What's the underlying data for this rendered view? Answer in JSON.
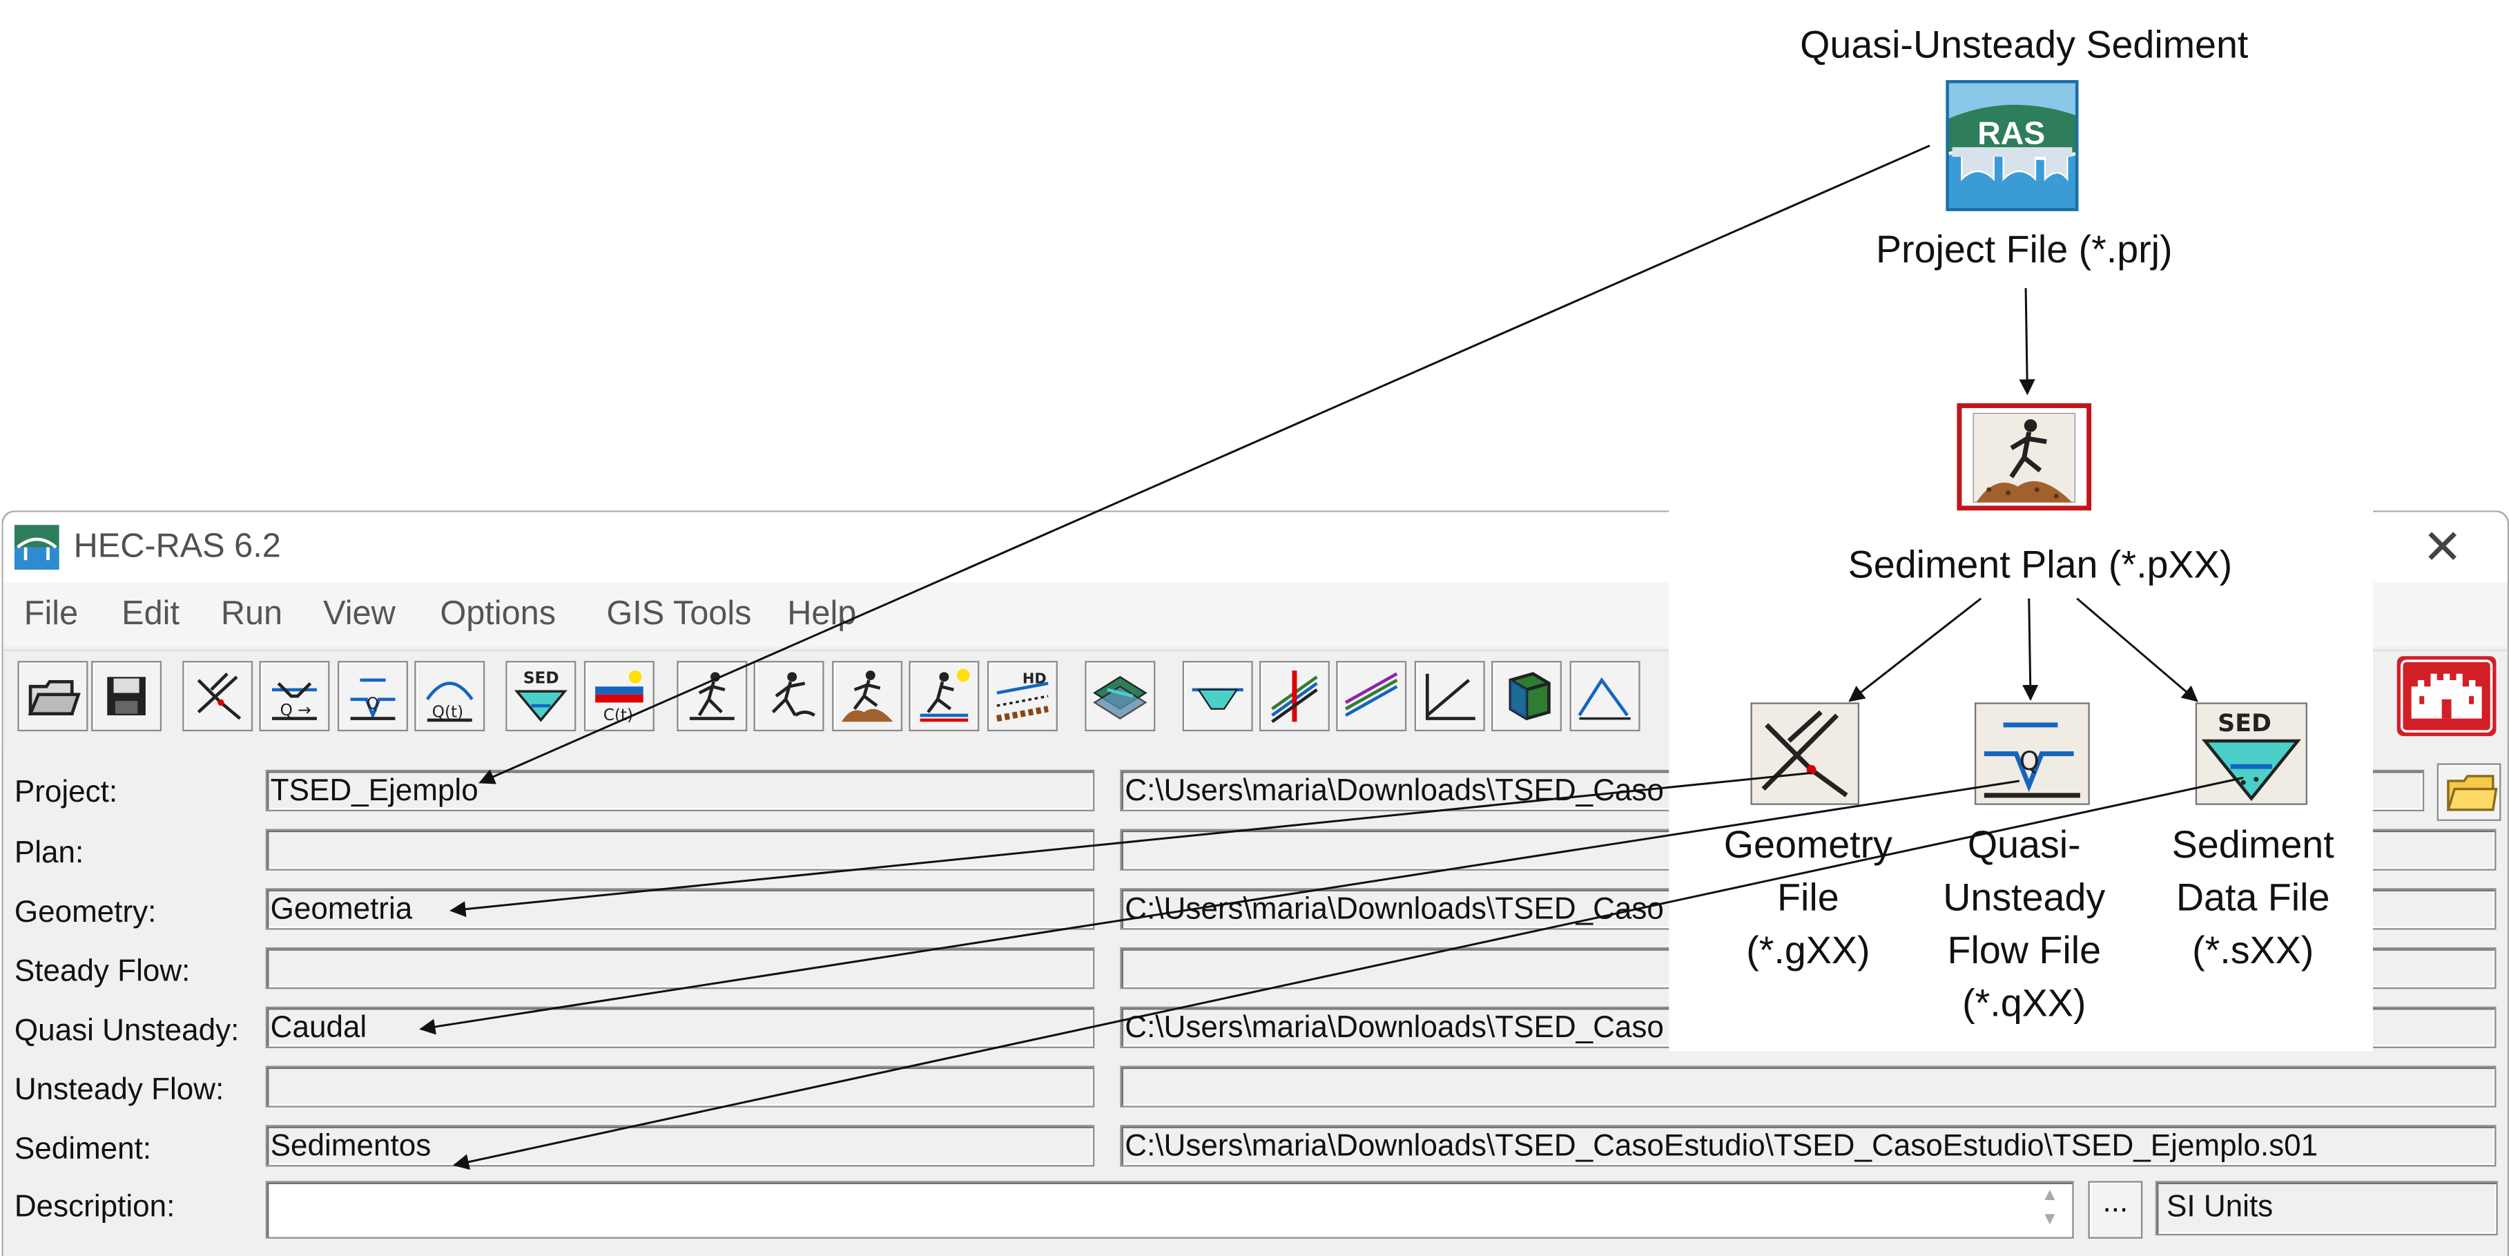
{
  "diagram": {
    "title": "Quasi-Unsteady Sediment",
    "project_file": "Project File (*.prj)",
    "ras_logo_text": "RAS",
    "sediment_plan": "Sediment Plan (*.pXX)",
    "geometry_file": [
      "Geometry",
      "File",
      "(*.gXX)"
    ],
    "flow_file": [
      "Quasi-",
      "Unsteady",
      "Flow File",
      "(*.qXX)"
    ],
    "sediment_data_file": [
      "Sediment",
      "Data File",
      "(*.sXX)"
    ],
    "sed_icon_text": "SED",
    "highlight_color": "#c0161c"
  },
  "window": {
    "title": "HEC-RAS 6.2",
    "close_glyph": "✕"
  },
  "menu": [
    "File",
    "Edit",
    "Run",
    "View",
    "Options",
    "GIS Tools",
    "Help"
  ],
  "toolbar": {
    "icons": [
      "open-project-icon",
      "save-project-icon",
      "geometry-editor-icon",
      "steady-flow-icon",
      "quasi-unsteady-flow-icon",
      "unsteady-flow-icon",
      "sediment-data-icon",
      "water-quality-icon",
      "steady-analysis-icon",
      "unsteady-analysis-icon",
      "sediment-analysis-icon",
      "water-quality-analysis-icon",
      "hydraulic-design-icon",
      "ras-mapper-icon",
      "cross-section-plot-icon",
      "profile-plot-icon",
      "general-profile-plot-icon",
      "rating-curve-icon",
      "3d-plot-icon",
      "hydrograph-icon"
    ],
    "sed_label": "SED",
    "ct_label": "C(t)",
    "hd_label": "HD",
    "usace_logo": "usace-castle-icon"
  },
  "form": {
    "labels": {
      "project": "Project:",
      "plan": "Plan:",
      "geometry": "Geometry:",
      "steady": "Steady Flow:",
      "quasi": "Quasi Unsteady:",
      "unsteady": "Unsteady Flow:",
      "sediment": "Sediment:",
      "description": "Description:"
    },
    "titles": {
      "project": "TSED_Ejemplo",
      "plan": "",
      "geometry": "Geometria",
      "steady": "",
      "quasi": "Caudal",
      "unsteady": "",
      "sediment": "Sedimentos"
    },
    "paths": {
      "project": "C:\\Users\\maria\\Downloads\\TSED_Caso",
      "plan": "",
      "geometry": "C:\\Users\\maria\\Downloads\\TSED_Caso",
      "steady": "",
      "quasi": "C:\\Users\\maria\\Downloads\\TSED_Caso",
      "unsteady": "",
      "sediment": "C:\\Users\\maria\\Downloads\\TSED_CasoEstudio\\TSED_CasoEstudio\\TSED_Ejemplo.s01"
    },
    "description_value": "",
    "ellipsis": "...",
    "units": "SI Units"
  }
}
